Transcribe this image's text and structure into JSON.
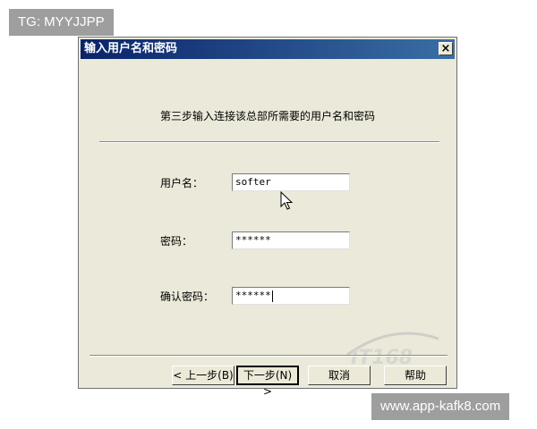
{
  "overlay": {
    "corner_tag": "TG: MYYJJPP",
    "footer_tag": "www.app-kafk8.com"
  },
  "dialog": {
    "title": "输入用户名和密码",
    "close_glyph": "×",
    "step_text": "第三步输入连接该总部所需要的用户名和密码",
    "fields": {
      "username": {
        "label": "用户名：",
        "value": "softer"
      },
      "password": {
        "label": "密码：",
        "value": "******"
      },
      "confirm": {
        "label": "确认密码：",
        "value": "******"
      }
    },
    "buttons": {
      "back": "< 上一步(B)",
      "next": "下一步(N) >",
      "cancel": "取消",
      "help": "帮助"
    },
    "watermark": "IT168"
  }
}
